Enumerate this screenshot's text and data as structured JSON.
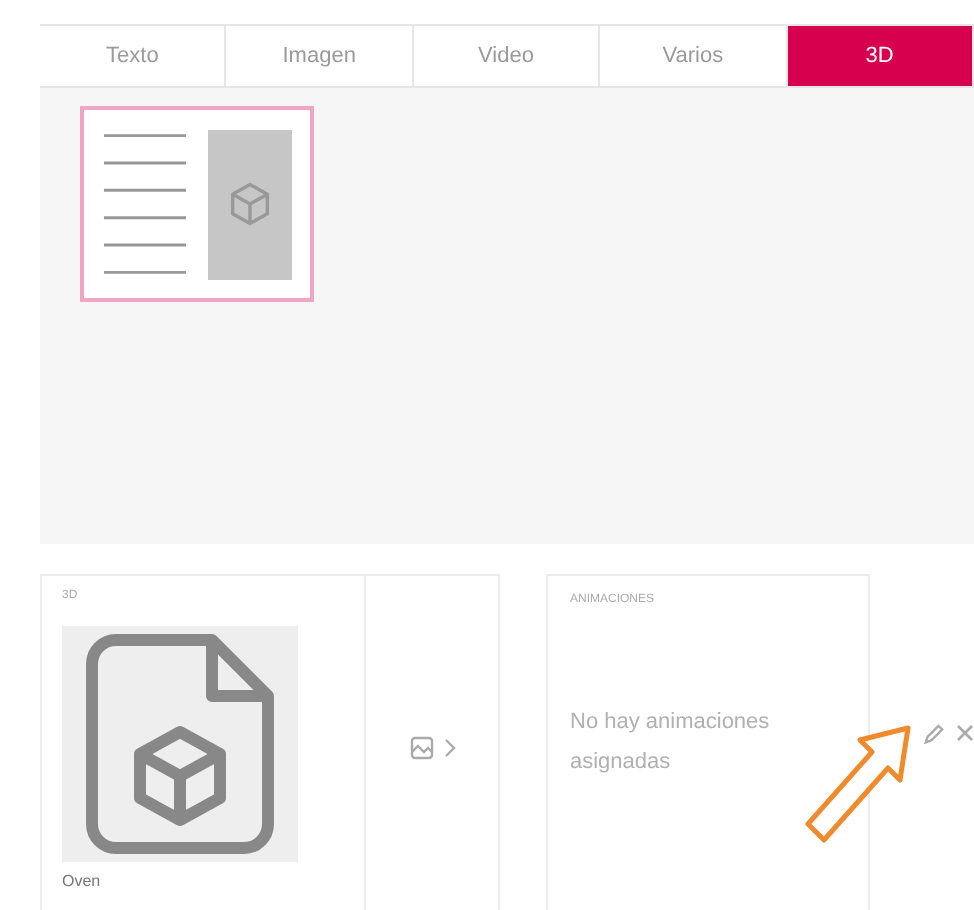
{
  "tabs": [
    {
      "label": "Texto",
      "selected": false
    },
    {
      "label": "Imagen",
      "selected": false
    },
    {
      "label": "Video",
      "selected": false
    },
    {
      "label": "Varios",
      "selected": false
    },
    {
      "label": "3D",
      "selected": true
    }
  ],
  "templates": [
    {
      "selected": true
    }
  ],
  "model_panel": {
    "label": "3D",
    "file_name": "Oven"
  },
  "animations_panel": {
    "label": "ANIMACIONES",
    "empty_message": "No hay animaciones asignadas"
  }
}
